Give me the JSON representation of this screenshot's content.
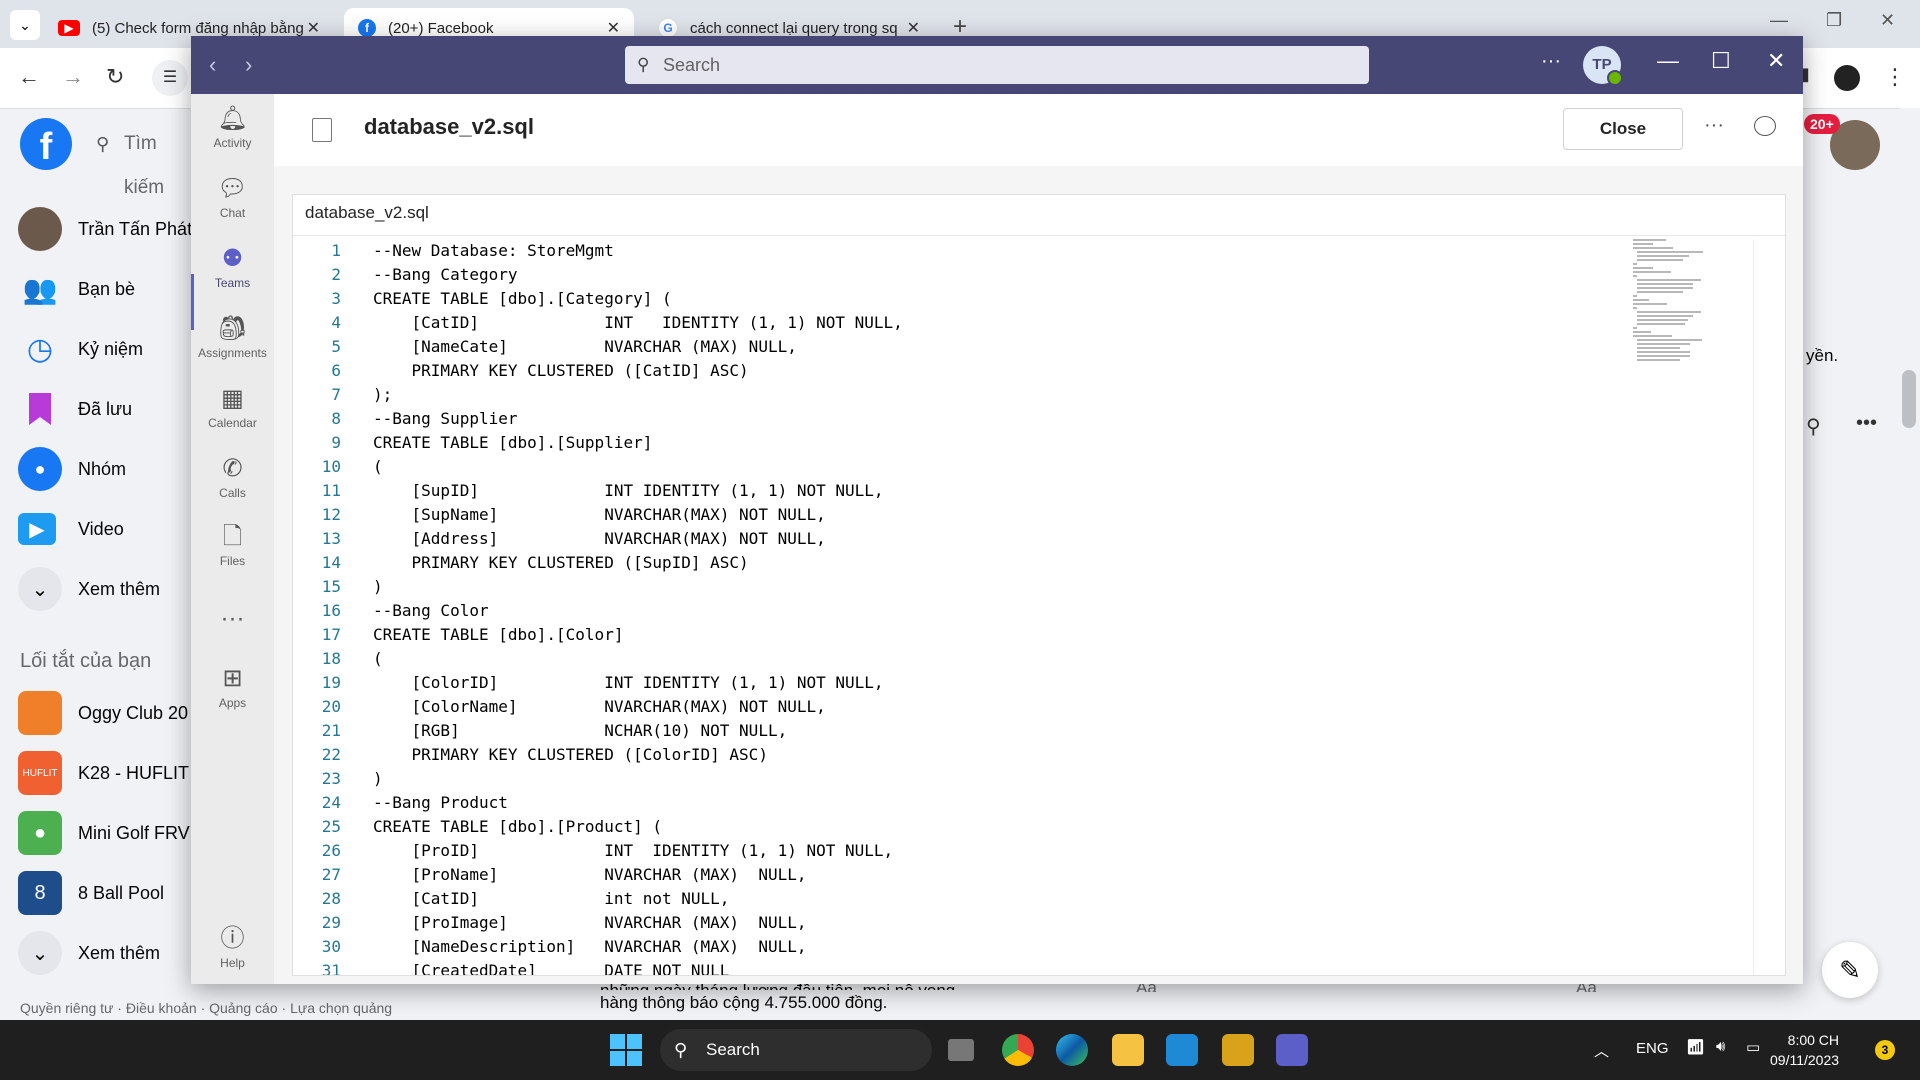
{
  "browser": {
    "tabs": [
      {
        "title": "(5) Check form đăng nhập bằng",
        "icon": "youtube-icon"
      },
      {
        "title": "(20+) Facebook",
        "icon": "facebook-icon"
      },
      {
        "title": "cách connect lại query trong sq",
        "icon": "google-icon"
      }
    ]
  },
  "facebook": {
    "logo": "f",
    "search_placeholder": "Tìm kiếm",
    "sidebar": [
      {
        "label": "Trần Tấn Phát",
        "icon": "profile-avatar"
      },
      {
        "label": "Bạn bè",
        "icon": "friends-icon"
      },
      {
        "label": "Kỷ niệm",
        "icon": "memories-icon"
      },
      {
        "label": "Đã lưu",
        "icon": "saved-icon"
      },
      {
        "label": "Nhóm",
        "icon": "groups-icon"
      },
      {
        "label": "Video",
        "icon": "video-icon"
      },
      {
        "label": "Xem thêm",
        "icon": "chevron-down-icon"
      }
    ],
    "shortcuts_title": "Lối tắt của bạn",
    "shortcuts": [
      {
        "label": "Oggy Club 20",
        "icon": "game-icon"
      },
      {
        "label": "K28 - HUFLIT",
        "icon": "group-icon"
      },
      {
        "label": "Mini Golf FRV",
        "icon": "game-icon"
      },
      {
        "label": "8 Ball Pool",
        "icon": "game-icon"
      },
      {
        "label": "Xem thêm",
        "icon": "chevron-down-icon"
      }
    ],
    "footer": "Quyền riêng tư · Điều khoản · Quảng cáo · Lựa chọn quảng",
    "notif_badge": "20+",
    "right_snippet": "yền.",
    "post_line1": "những ngày tháng lương đầu tiên, mọi nỗ vọng",
    "post_line2": "hàng thông báo cộng 4.755.000 đồng.",
    "comment_placeholder": "Aa"
  },
  "teams": {
    "search_placeholder": "Search",
    "avatar_initials": "TP",
    "rail": [
      {
        "label": "Activity",
        "icon": "bell-icon"
      },
      {
        "label": "Chat",
        "icon": "chat-icon"
      },
      {
        "label": "Teams",
        "icon": "teams-icon"
      },
      {
        "label": "Assignments",
        "icon": "assignments-icon"
      },
      {
        "label": "Calendar",
        "icon": "calendar-icon"
      },
      {
        "label": "Calls",
        "icon": "phone-icon"
      },
      {
        "label": "Files",
        "icon": "file-icon"
      },
      {
        "label": "...",
        "icon": "more-icon"
      },
      {
        "label": "Apps",
        "icon": "apps-icon"
      },
      {
        "label": "Help",
        "icon": "help-icon"
      }
    ],
    "file_title": "database_v2.sql",
    "close_label": "Close",
    "editor_tab": "database_v2.sql",
    "code_lines": [
      "--New Database: StoreMgmt",
      "--Bang Category",
      "CREATE TABLE [dbo].[Category] (",
      "    [CatID]             INT   IDENTITY (1, 1) NOT NULL,",
      "    [NameCate]          NVARCHAR (MAX) NULL,",
      "    PRIMARY KEY CLUSTERED ([CatID] ASC)",
      ");",
      "--Bang Supplier",
      "CREATE TABLE [dbo].[Supplier]",
      "(",
      "    [SupID]             INT IDENTITY (1, 1) NOT NULL,",
      "    [SupName]           NVARCHAR(MAX) NOT NULL,",
      "    [Address]           NVARCHAR(MAX) NOT NULL,",
      "    PRIMARY KEY CLUSTERED ([SupID] ASC)",
      ")",
      "--Bang Color",
      "CREATE TABLE [dbo].[Color]",
      "(",
      "    [ColorID]           INT IDENTITY (1, 1) NOT NULL,",
      "    [ColorName]         NVARCHAR(MAX) NOT NULL,",
      "    [RGB]               NCHAR(10) NOT NULL,",
      "    PRIMARY KEY CLUSTERED ([ColorID] ASC)",
      ")",
      "--Bang Product",
      "CREATE TABLE [dbo].[Product] (",
      "    [ProID]             INT  IDENTITY (1, 1) NOT NULL,",
      "    [ProName]           NVARCHAR (MAX)  NULL,",
      "    [CatID]             int not NULL,",
      "    [ProImage]          NVARCHAR (MAX)  NULL,",
      "    [NameDescription]   NVARCHAR (MAX)  NULL,",
      "    [CreatedDate]       DATE NOT NULL"
    ]
  },
  "taskbar": {
    "search_label": "Search",
    "lang": "ENG",
    "time": "8:00 CH",
    "date": "09/11/2023",
    "notif_count": "3"
  }
}
